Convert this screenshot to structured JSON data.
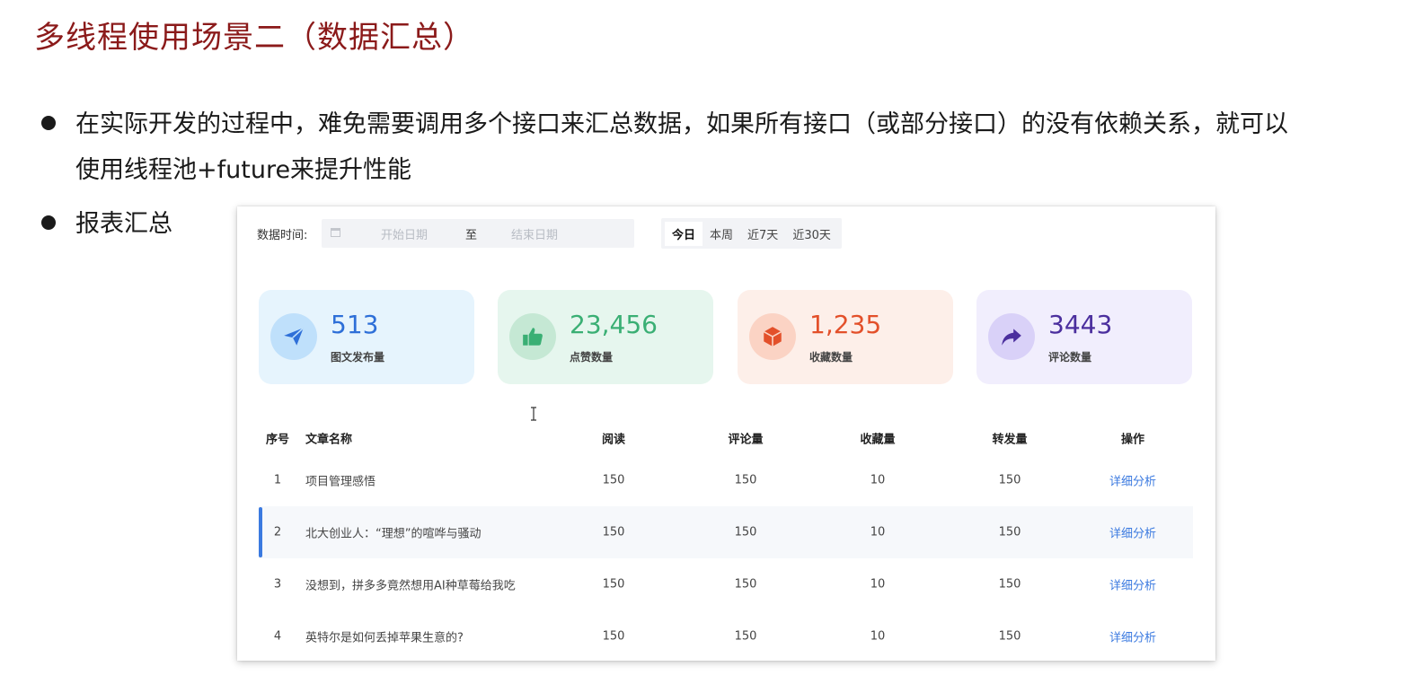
{
  "slide": {
    "title": "多线程使用场景二（数据汇总）",
    "bullets": [
      {
        "line1": "在实际开发的过程中，难免需要调用多个接口来汇总数据，如果所有接口（或部分接口）的没有依赖关系，就可以",
        "line2": "使用线程池+future来提升性能"
      },
      {
        "line1": "报表汇总"
      }
    ]
  },
  "report": {
    "filter": {
      "label": "数据时间:",
      "start_placeholder": "开始日期",
      "separator": "至",
      "end_placeholder": "结束日期",
      "calendar_icon": "calendar-icon"
    },
    "range_tabs": [
      {
        "label": "今日",
        "active": true
      },
      {
        "label": "本周",
        "active": false
      },
      {
        "label": "近7天",
        "active": false
      },
      {
        "label": "近30天",
        "active": false
      }
    ],
    "stats": [
      {
        "value": "513",
        "label": "图文发布量",
        "icon": "paper-plane-icon",
        "color": "#2e6fd8",
        "bg": "#e6f4fd",
        "icon_bg": "#bfe0fb"
      },
      {
        "value": "23,456",
        "label": "点赞数量",
        "icon": "thumbs-up-icon",
        "color": "#3aaf74",
        "bg": "#e6f6ee",
        "icon_bg": "#c5e8d4"
      },
      {
        "value": "1,235",
        "label": "收藏数量",
        "icon": "cube-icon",
        "color": "#e3502a",
        "bg": "#fdefe9",
        "icon_bg": "#fbd3c4"
      },
      {
        "value": "3443",
        "label": "评论数量",
        "icon": "share-arrow-icon",
        "color": "#4b2f9e",
        "bg": "#f1eefd",
        "icon_bg": "#d9d1f8"
      }
    ],
    "table": {
      "headers": {
        "no": "序号",
        "title": "文章名称",
        "read": "阅读",
        "comment": "评论量",
        "collect": "收藏量",
        "share": "转发量",
        "op": "操作"
      },
      "rows": [
        {
          "no": "1",
          "title": "项目管理感悟",
          "read": "150",
          "comment": "150",
          "collect": "10",
          "share": "150",
          "op": "详细分析"
        },
        {
          "no": "2",
          "title": "北大创业人：“理想”的喧哗与骚动",
          "read": "150",
          "comment": "150",
          "collect": "10",
          "share": "150",
          "op": "详细分析"
        },
        {
          "no": "3",
          "title": "没想到，拼多多竟然想用AI种草莓给我吃",
          "read": "150",
          "comment": "150",
          "collect": "10",
          "share": "150",
          "op": "详细分析"
        },
        {
          "no": "4",
          "title": "英特尔是如何丢掉苹果生意的?",
          "read": "150",
          "comment": "150",
          "collect": "10",
          "share": "150",
          "op": "详细分析"
        }
      ]
    }
  }
}
